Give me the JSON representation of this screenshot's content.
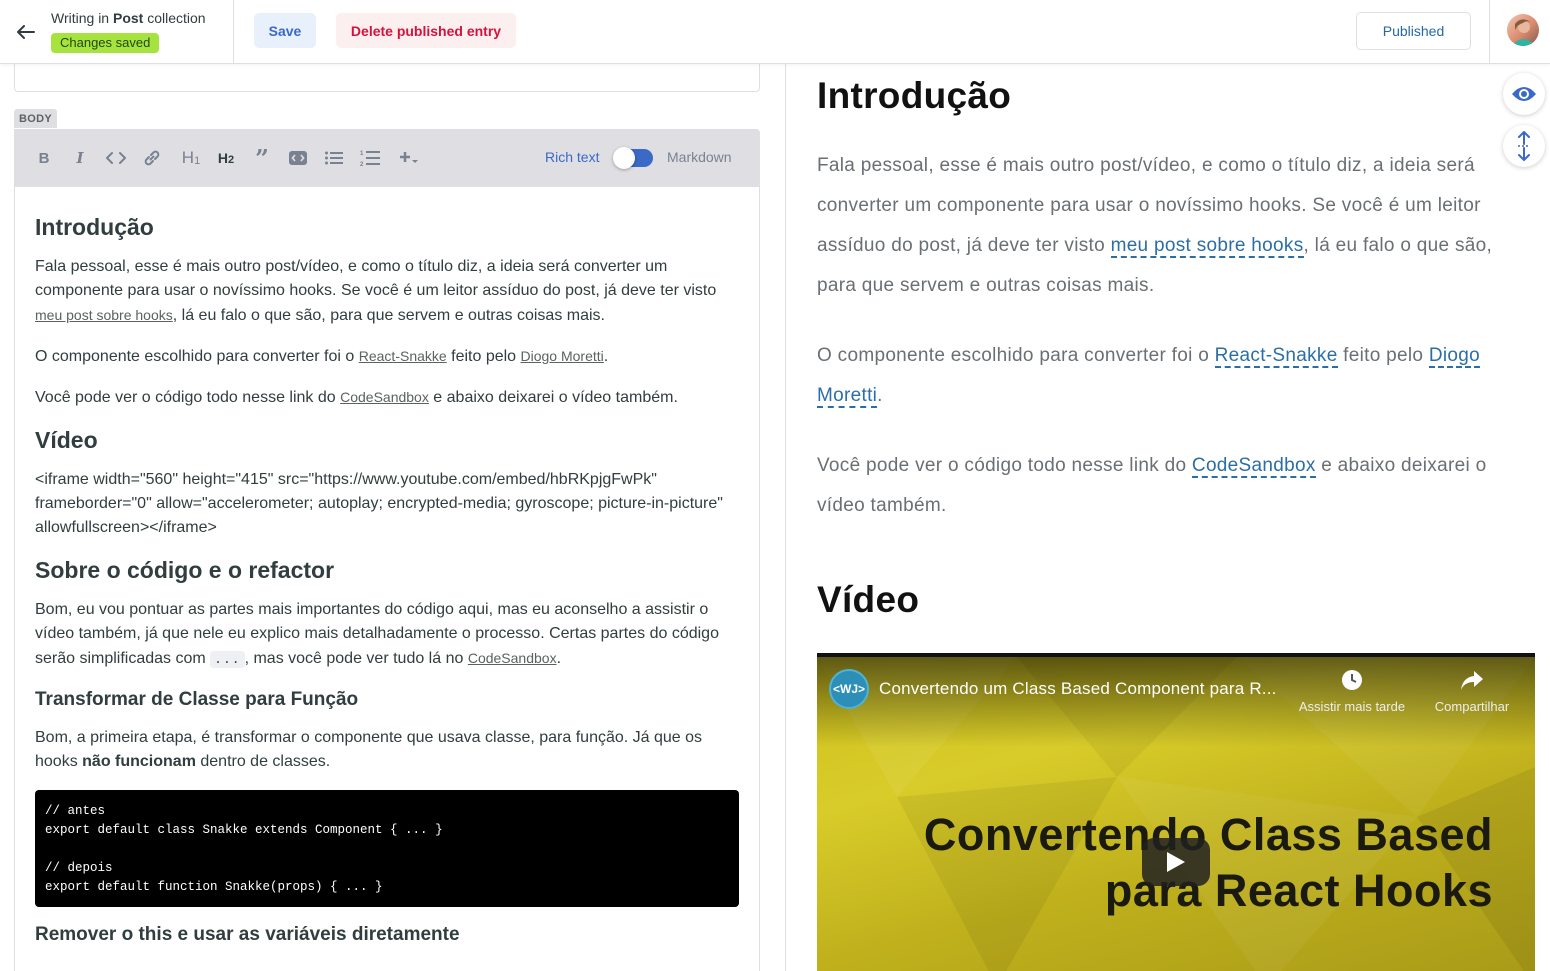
{
  "topbar": {
    "title_prefix": "Writing in",
    "collection": "Post",
    "title_suffix": "collection",
    "status": "Changes saved",
    "save_label": "Save",
    "delete_label": "Delete published entry",
    "published_label": "Published"
  },
  "editor": {
    "field_label": "BODY",
    "mode_rich": "Rich text",
    "mode_markdown": "Markdown",
    "toolbar_icons": [
      "bold-icon",
      "italic-icon",
      "code-icon",
      "link-icon",
      "heading1-icon",
      "heading2-icon",
      "quote-icon",
      "code-block-icon",
      "bulleted-list-icon",
      "numbered-list-icon",
      "add-component-icon"
    ],
    "h_intro": "Introdução",
    "p1_a": "Fala pessoal, esse é mais outro post/vídeo, e como o título diz, a ideia será converter um componente para usar o novíssimo hooks. Se você é um leitor assíduo do post, já deve ter visto ",
    "p1_link": "meu post sobre hooks",
    "p1_b": ", lá eu falo o que são, para que servem e outras coisas mais.",
    "p2_a": "O componente escolhido para converter foi o ",
    "p2_link1": "React-Snakke",
    "p2_b": " feito pelo ",
    "p2_link2": "Diogo Moretti",
    "p2_c": ".",
    "p3_a": "Você pode ver o código todo nesse link do ",
    "p3_link": "CodeSandbox",
    "p3_b": " e abaixo deixarei o vídeo também.",
    "h_video": "Vídeo",
    "iframe_text": "<iframe width=\"560\" height=\"415\" src=\"https://www.youtube.com/embed/hbRKpjgFwPk\" frameborder=\"0\" allow=\"accelerometer; autoplay; encrypted-media; gyroscope; picture-in-picture\" allowfullscreen></iframe>",
    "h_sobre": "Sobre o código e o refactor",
    "p4_a": "Bom, eu vou pontuar as partes mais importantes do código aqui, mas eu aconselho a assistir o vídeo também, já que nele eu explico mais detalhadamente o processo. Certas partes do código serão simplificadas com ",
    "p4_code": "...",
    "p4_b": ", mas você pode ver tudo lá no ",
    "p4_link": "CodeSandbox",
    "p4_c": ".",
    "h_transformar": "Transformar de Classe para Função",
    "p5_a": "Bom, a primeira etapa, é transformar o componente que usava classe, para função. Já que os hooks ",
    "p5_bold": "não funcionam",
    "p5_b": " dentro de classes.",
    "code": "// antes\nexport default class Snakke extends Component { ... }\n\n// depois\nexport default function Snakke(props) { ... }",
    "h_remover": "Remover o this e usar as variáveis diretamente"
  },
  "preview": {
    "h_intro": "Introdução",
    "p1_a": "Fala pessoal, esse é mais outro post/vídeo, e como o título diz, a ideia será converter um componente para usar o novíssimo hooks. Se você é um leitor assíduo do post, já deve ter visto ",
    "p1_link": "meu post sobre hooks",
    "p1_b": ", lá eu falo o que são, para que servem e outras coisas mais.",
    "p2_a": "O componente escolhido para converter foi o ",
    "p2_link1": "React-Snakke",
    "p2_b": " feito pelo ",
    "p2_link2": "Diogo Moretti",
    "p2_c": ".",
    "p3_a": "Você pode ver o código todo nesse link do ",
    "p3_link": "CodeSandbox",
    "p3_b": " e abaixo deixarei o vídeo também.",
    "h_video": "Vídeo",
    "video": {
      "channel_logo": "<WJ>",
      "title": "Convertendo um Class Based Component para R...",
      "watch_later": "Assistir mais tarde",
      "share": "Compartilhar",
      "big_line1": "Convertendo Class Based",
      "big_line2": "para React Hooks"
    }
  },
  "colors": {
    "accent": "#3a69c7",
    "status_badge": "#a7e33e",
    "danger": "#d6123c",
    "link_preview": "#2b6ea6"
  }
}
